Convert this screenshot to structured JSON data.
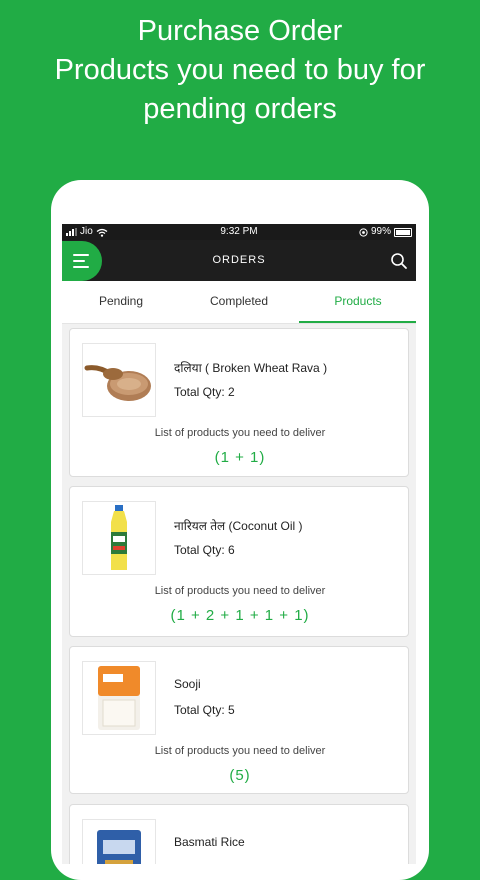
{
  "promo": {
    "line1": "Purchase Order",
    "line2": "Products you need to buy for",
    "line3": "pending orders"
  },
  "status_bar": {
    "carrier": "Jio",
    "time": "9:32 PM",
    "battery": "99%"
  },
  "app_bar": {
    "title": "ORDERS",
    "menu_icon": "hamburger-menu-icon",
    "search_icon": "search-icon"
  },
  "tabs": [
    {
      "label": "Pending",
      "active": false
    },
    {
      "label": "Completed",
      "active": false
    },
    {
      "label": "Products",
      "active": true
    }
  ],
  "products": [
    {
      "name": "दलिया ( Broken Wheat Rava )",
      "qty_text": "Total Qty: 2",
      "list_label": "List of products you need to deliver",
      "breakdown": "(1  +  1)",
      "image": "broken-wheat-rava-image"
    },
    {
      "name": "नारियल तेल (Coconut Oil )",
      "qty_text": "Total Qty: 6",
      "list_label": "List of products you need to deliver",
      "breakdown": "(1  +  2  +  1  +  1  +  1)",
      "image": "coconut-oil-bottle-image"
    },
    {
      "name": "Sooji",
      "qty_text": "Total Qty: 5",
      "list_label": "List of products you need to deliver",
      "breakdown": "(5)",
      "image": "sooji-pack-image"
    },
    {
      "name": "Basmati Rice",
      "image": "basmati-rice-bag-image"
    }
  ],
  "colors": {
    "brand_green": "#21ac45",
    "app_bar": "#1e1e1e"
  }
}
